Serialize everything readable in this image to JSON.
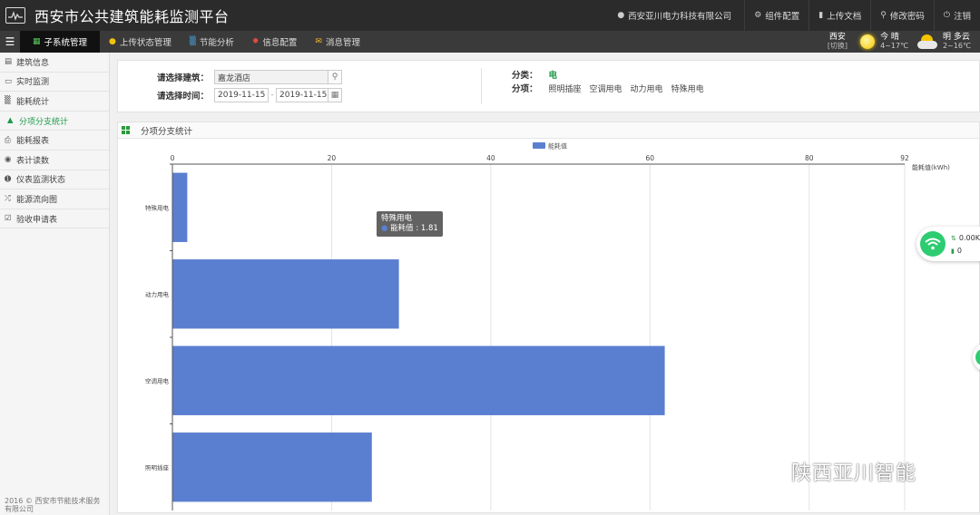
{
  "header": {
    "title": "西安市公共建筑能耗监测平台",
    "company": "西安亚川电力科技有限公司",
    "actions": [
      {
        "label": "组件配置",
        "icon": "gear-icon"
      },
      {
        "label": "上传文档",
        "icon": "book-icon"
      },
      {
        "label": "修改密码",
        "icon": "key-icon"
      },
      {
        "label": "注销",
        "icon": "power-icon"
      }
    ]
  },
  "nav": {
    "tabs": [
      {
        "label": "子系统管理",
        "icon": "grid-icon"
      },
      {
        "label": "上传状态管理",
        "icon": "info-icon"
      },
      {
        "label": "节能分析",
        "icon": "bar-chart-icon"
      },
      {
        "label": "信息配置",
        "icon": "settings-icon"
      },
      {
        "label": "消息管理",
        "icon": "mail-icon"
      }
    ]
  },
  "weather": {
    "city": "西安",
    "city_sub": "[切换]",
    "today": {
      "label": "今 晴",
      "temp": "4~17℃"
    },
    "tomorrow": {
      "label": "明 多云",
      "temp": "2~16℃"
    }
  },
  "sidebar": {
    "items": [
      {
        "label": "建筑信息",
        "icon": "document-icon"
      },
      {
        "label": "实时监测",
        "icon": "monitor-icon"
      },
      {
        "label": "能耗统计",
        "icon": "bar-chart-icon"
      },
      {
        "label": "分项分支统计",
        "icon": "sitemap-icon"
      },
      {
        "label": "能耗报表",
        "icon": "print-icon"
      },
      {
        "label": "表计读数",
        "icon": "car-icon"
      },
      {
        "label": "仪表监测状态",
        "icon": "info-circle-icon"
      },
      {
        "label": "能源流向图",
        "icon": "random-icon"
      },
      {
        "label": "验收申请表",
        "icon": "checkbox-icon"
      }
    ],
    "footer": "2016 © 西安市节能技术服务有限公司"
  },
  "filter": {
    "building_label": "请选择建筑：",
    "building_value": "嘉龙酒店",
    "time_label": "请选择时间：",
    "date_start": "2019-11-15",
    "date_sep": "-",
    "date_end": "2019-11-15",
    "category_label": "分类：",
    "category_value": "电",
    "subitem_label": "分项：",
    "subitems": [
      "照明插座",
      "空调用电",
      "动力用电",
      "特殊用电"
    ]
  },
  "chart_panel": {
    "title": "分项分支统计"
  },
  "chart_data": {
    "type": "bar",
    "orientation": "horizontal",
    "categories": [
      "特殊用电",
      "动力用电",
      "空调用电",
      "照明插座"
    ],
    "series": [
      {
        "name": "能耗值",
        "values": [
          1.81,
          28.4,
          61.8,
          25.0
        ]
      }
    ],
    "xlabel": "能耗值(kWh)",
    "xlim": [
      0,
      92
    ],
    "xticks": [
      0,
      20,
      40,
      60,
      80,
      92
    ],
    "grid": true,
    "legend": "top-center",
    "color": "#5b7fd0"
  },
  "tooltip": {
    "title": "特殊用电",
    "line": "能耗值 : 1.81"
  },
  "net_widget": {
    "speed": "0.00K",
    "count": "0"
  },
  "watermark": "陕西亚川智能"
}
